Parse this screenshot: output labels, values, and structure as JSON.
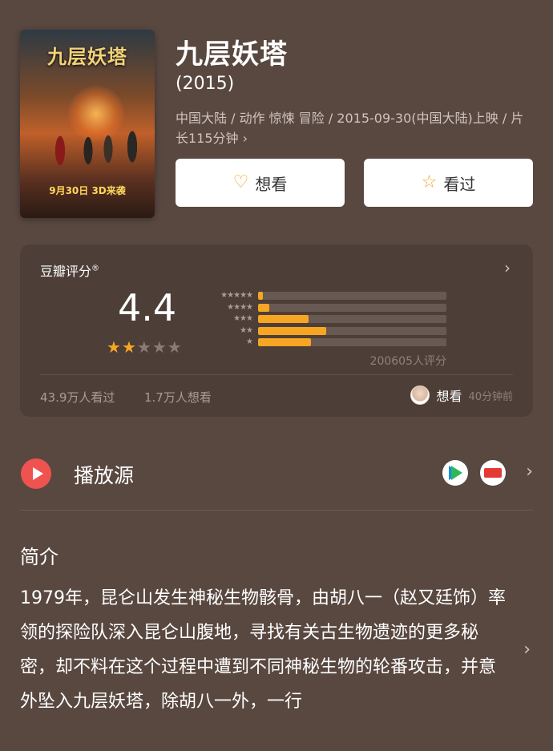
{
  "movie": {
    "poster_title": "九层妖塔",
    "poster_date": "9月30日 3D来袭",
    "title": "九层妖塔",
    "year": "(2015)",
    "meta": "中国大陆 / 动作 惊悚 冒险 / 2015-09-30(中国大陆)上映 / 片长115分钟 ›"
  },
  "buttons": {
    "want_label": "想看",
    "seen_label": "看过",
    "want_icon": "heart-plus-icon",
    "seen_icon": "star-icon"
  },
  "rating": {
    "label": "豆瓣评分",
    "registered": "®",
    "score": "4.4",
    "stars_filled": 2,
    "stars_total": 5,
    "distribution": [
      {
        "stars": "★★★★★",
        "fraction": 0.025
      },
      {
        "stars": "★★★★",
        "fraction": 0.06
      },
      {
        "stars": "★★★",
        "fraction": 0.27
      },
      {
        "stars": "★★",
        "fraction": 0.36
      },
      {
        "stars": "★",
        "fraction": 0.28
      }
    ],
    "count_text": "200605人评分",
    "seen_text": "43.9万人看过",
    "wish_text": "1.7万人想看",
    "user_action": "想看",
    "user_time": "40分钟前"
  },
  "source": {
    "label": "播放源",
    "providers": [
      "tencent-video-icon",
      "bilibili-icon"
    ]
  },
  "intro": {
    "title": "简介",
    "text": "1979年，昆仑山发生神秘生物骸骨，由胡八一（赵又廷饰）率领的探险队深入昆仑山腹地，寻找有关古生物遗迹的更多秘密，却不料在这个过程中遭到不同神秘生物的轮番攻击，并意外坠入九层妖塔，除胡八一外，一行"
  },
  "colors": {
    "background": "#594840",
    "card": "#4d3f38",
    "accent": "#f6a623",
    "play": "#ef5350"
  }
}
